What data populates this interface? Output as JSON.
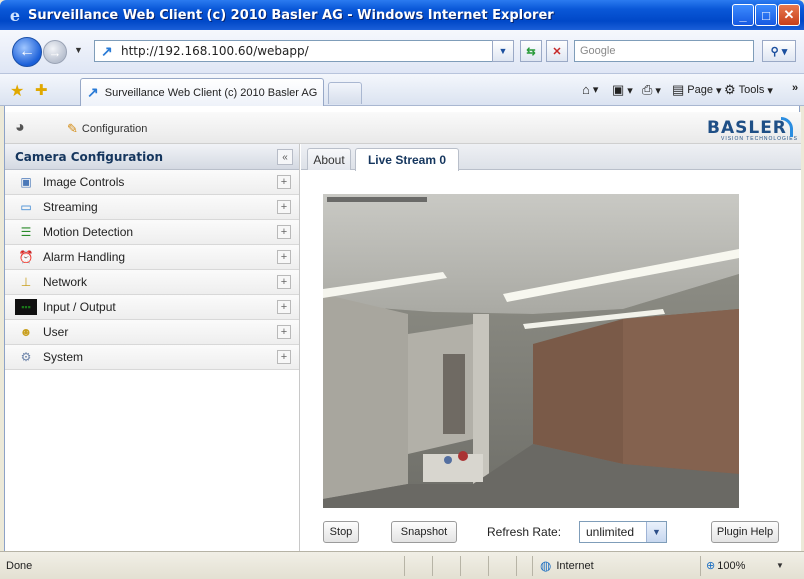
{
  "window": {
    "title": "Surveillance Web Client (c) 2010 Basler AG - Windows Internet Explorer"
  },
  "browser": {
    "url": "http://192.168.100.60/webapp/",
    "search_placeholder": "Google",
    "tab_label": "Surveillance Web Client (c) 2010 Basler AG",
    "commands": {
      "page": "Page",
      "tools": "Tools"
    }
  },
  "app": {
    "top": {
      "configuration_label": "Configuration",
      "logo": "BASLER",
      "logo_sub": "VISION TECHNOLOGIES"
    },
    "left_panel": {
      "title": "Camera Configuration",
      "items": [
        {
          "label": "Image Controls",
          "icon": "image-controls-icon"
        },
        {
          "label": "Streaming",
          "icon": "streaming-icon"
        },
        {
          "label": "Motion Detection",
          "icon": "motion-detection-icon"
        },
        {
          "label": "Alarm Handling",
          "icon": "alarm-handling-icon"
        },
        {
          "label": "Network",
          "icon": "network-icon"
        },
        {
          "label": "Input / Output",
          "icon": "input-output-icon"
        },
        {
          "label": "User",
          "icon": "user-icon"
        },
        {
          "label": "System",
          "icon": "system-icon"
        }
      ]
    },
    "tabs": {
      "about": "About",
      "live": "Live Stream 0"
    },
    "controls": {
      "stop": "Stop",
      "snapshot": "Snapshot",
      "refresh_label": "Refresh Rate:",
      "refresh_value": "unlimited",
      "plugin_help": "Plugin Help"
    }
  },
  "status": {
    "text": "Done",
    "zone": "Internet",
    "zoom": "100%"
  }
}
